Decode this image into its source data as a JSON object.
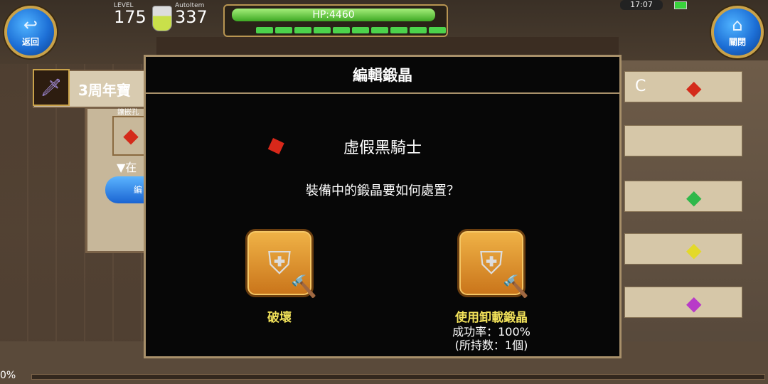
{
  "hud": {
    "back_label": "返回",
    "close_label": "關閉",
    "level_label": "LEVEL",
    "level_value": "175",
    "autoitem_label": "AutoItem",
    "autoitem_value": "337",
    "hp_text": "HP:4460",
    "hp_fraction": 1.0,
    "mp_segments": 10,
    "clock": "17:07",
    "battery_color": "#39d23c"
  },
  "background": {
    "item_title": "3周年寶",
    "slot_label": "鑲嵌孔",
    "tri_text": "▼在",
    "blue_btn_text": "編",
    "right_rows": [
      {
        "letter": "C",
        "gem_color": "#d42a1a"
      },
      {
        "letter": "",
        "gem_color": ""
      },
      {
        "letter": "",
        "gem_color": "#2fb84a"
      },
      {
        "letter": "",
        "gem_color": "#e3d92a"
      },
      {
        "letter": "",
        "gem_color": "#b83ac8"
      }
    ],
    "progress_text": "0%"
  },
  "modal": {
    "title": "編輯鍛晶",
    "crystal_name": "虛假黑騎士",
    "crystal_color": "#d8281a",
    "question": "裝備中的鍛晶要如何處置？",
    "actions": {
      "destroy": {
        "label": "破壞"
      },
      "unload": {
        "label": "使用卸載鍛晶",
        "success_rate": "成功率：100%",
        "owned": "(所持数：1個)"
      }
    }
  }
}
